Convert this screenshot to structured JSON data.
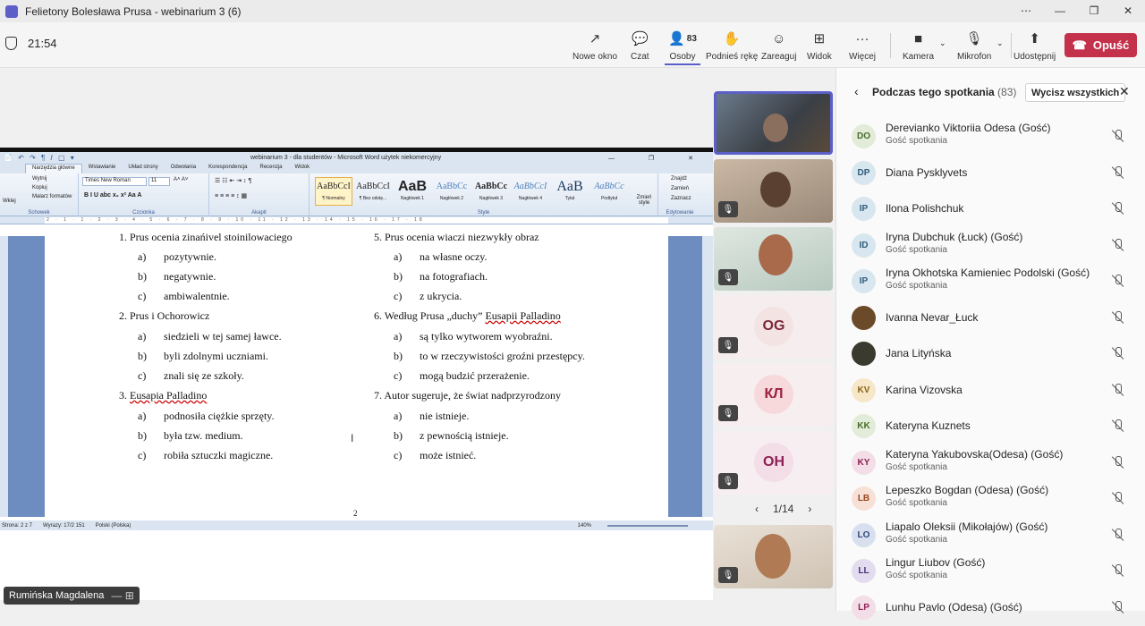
{
  "window": {
    "title": "Felietony Bolesława Prusa - webinarium 3 (6)",
    "controls": [
      "⋯",
      "—",
      "❐",
      "✕"
    ]
  },
  "meeting": {
    "timer": "21:54"
  },
  "toolbar": {
    "new_window": "Nowe okno",
    "chat": "Czat",
    "people": "Osoby",
    "people_count": "83",
    "raise_hand": "Podnieś rękę",
    "react": "Zareaguj",
    "view": "Widok",
    "more": "Więcej",
    "camera": "Kamera",
    "mic": "Mikrofon",
    "share": "Udostępnij",
    "leave": "Opuść",
    "icons": {
      "new_window": "↗",
      "chat": "💬",
      "people": "👤",
      "raise_hand": "✋",
      "react": "☺",
      "view": "⊞",
      "more": "···",
      "camera": "■",
      "mic": "🎙",
      "share": "⬆",
      "leave": "☎"
    }
  },
  "word": {
    "title": "webinarium 3 - dla studentów - Microsoft Word użytek niekomercyjny",
    "quick_access": "📄 ↶ ↷ ¶ 𝐼 ▢ ▾",
    "window_controls": "— ❐ ✕",
    "tabs": [
      "Narzędzia główne",
      "Wstawianie",
      "Układ strony",
      "Odwołania",
      "Korespondencja",
      "Recenzja",
      "Widok"
    ],
    "clipboard": {
      "paste": "Wklej",
      "cut": "Wytnij",
      "copy": "Kopiuj",
      "format": "Malarz formatów",
      "label": "Schowek"
    },
    "font": {
      "name": "Times New Roman",
      "size": "11",
      "label": "Czcionka",
      "grow": "A˄ A˅",
      "style_buttons": "B I U abc x₂ x² Aa A"
    },
    "paragraph": {
      "label": "Akapit",
      "row1": "☰ ☷ ⇤ ⇥ ↕ ¶",
      "row2": "≡ ≡ ≡ ≡ ↕ ▦"
    },
    "styles": [
      {
        "preview": "AaBbCcI",
        "name": "¶ Normalny"
      },
      {
        "preview": "AaBbCcI",
        "name": "¶ Bez odstę..."
      },
      {
        "preview": "AaB",
        "name": "Nagłówek 1"
      },
      {
        "preview": "AaBbCc",
        "name": "Nagłówek 2"
      },
      {
        "preview": "AaBbCc",
        "name": "Nagłówek 3"
      },
      {
        "preview": "AaBbCcI",
        "name": "Nagłówek 4"
      },
      {
        "preview": "AaB",
        "name": "Tytuł"
      },
      {
        "preview": "AaBbCc",
        "name": "Podtytuł"
      }
    ],
    "styles_label": "Style",
    "change_styles": "Zmień style",
    "editing": {
      "find": "Znajdź",
      "replace": "Zamień",
      "select": "Zaznacz",
      "label": "Edytowanie"
    },
    "ruler_marks": "2 · 1 · 1 · 2 · 3 · 4 · 5 · 6 · 7 · 8 · 9 · 10 · 11 · 12 · 13 · 14 · 15 · 16 · 17 · 18",
    "doc": {
      "top_cut_left": "1. Prus ocenia zinańivel stoinilowaciego",
      "top_cut_right": "5. Prus ocenia wiaczi niezwykły obraz",
      "q1_opts": [
        [
          "a)",
          "pozytywnie."
        ],
        [
          "b)",
          "negatywnie."
        ],
        [
          "c)",
          "ambiwalentnie."
        ]
      ],
      "q5_opts": [
        [
          "a)",
          "na własne oczy."
        ],
        [
          "b)",
          "na fotografiach."
        ],
        [
          "c)",
          "z ukrycia."
        ]
      ],
      "q2": "2. Prus i Ochorowicz",
      "q2_opts": [
        [
          "a)",
          "siedzieli w tej samej ławce."
        ],
        [
          "b)",
          "byli zdolnymi uczniami."
        ],
        [
          "c)",
          "znali się ze szkoły."
        ]
      ],
      "q6_pre": "6. Według Prusa „duchy” ",
      "q6_u": "Eusapii Palladino",
      "q6_opts": [
        [
          "a)",
          "są tylko wytworem wyobraźni."
        ],
        [
          "b)",
          "to w rzeczywistości groźni przestępcy."
        ],
        [
          "c)",
          "mogą budzić przerażenie."
        ]
      ],
      "q3_pre": "3. ",
      "q3_u": "Eusapia Palladino",
      "q3_opts": [
        [
          "a)",
          "podnosiła ciężkie sprzęty."
        ],
        [
          "b)",
          "była tzw. medium."
        ],
        [
          "c)",
          "robiła sztuczki magiczne."
        ]
      ],
      "q7": "7. Autor sugeruje, że świat nadprzyrodzony",
      "q7_opts": [
        [
          "a)",
          "nie istnieje."
        ],
        [
          "b)",
          "z pewnością istnieje."
        ],
        [
          "c)",
          "może istnieć."
        ]
      ],
      "page_number": "2"
    },
    "status": {
      "page": "Strona: 2 z 7",
      "words": "Wyrazy: 17/2 151",
      "lang": "Polski (Polska)",
      "zoom": "140%"
    }
  },
  "presenter": {
    "name": "Rumińska Magdalena",
    "controls": "— ⊞"
  },
  "gallery": {
    "tiles": [
      {
        "initials": "OG",
        "bg": "#f3e3e3",
        "fg": "#7a2a3a"
      },
      {
        "initials": "КЛ",
        "bg": "#f7d9dc",
        "fg": "#9b2040"
      },
      {
        "initials": "ОН",
        "bg": "#f3dde6",
        "fg": "#8e2054"
      }
    ],
    "page": "1/14"
  },
  "panel": {
    "title": "Podczas tego spotkania",
    "count": "(83)",
    "mute_all": "Wycisz wszystkich",
    "participants": [
      {
        "initials": "DO",
        "name": "Derevianko Viktoriia Odesa (Gość)",
        "role": "Gość spotkania",
        "bg": "#e2ecd8",
        "fg": "#4a6b2a"
      },
      {
        "initials": "DP",
        "name": "Diana Pysklyvets",
        "role": "",
        "bg": "#d8e6ef",
        "fg": "#2f5b7a"
      },
      {
        "initials": "IP",
        "name": "Ilona Polishchuk",
        "role": "",
        "bg": "#d8e6ef",
        "fg": "#2f5b7a"
      },
      {
        "initials": "ID",
        "name": "Iryna Dubchuk (Łuck) (Gość)",
        "role": "Gość spotkania",
        "bg": "#d8e6ef",
        "fg": "#2f5b7a"
      },
      {
        "initials": "IP",
        "name": "Iryna Okhotska Kamieniec Podolski (Gość)",
        "role": "Gość spotkania",
        "bg": "#d8e6ef",
        "fg": "#2f5b7a"
      },
      {
        "initials": "",
        "name": "Ivanna Nevar_Łuck",
        "role": "",
        "bg": "#6b4a2a",
        "fg": "#fff"
      },
      {
        "initials": "",
        "name": "Jana Lityńska",
        "role": "",
        "bg": "#3a3a2e",
        "fg": "#fff"
      },
      {
        "initials": "KV",
        "name": "Karina Vizovska",
        "role": "",
        "bg": "#f6e7c8",
        "fg": "#8a6414"
      },
      {
        "initials": "KK",
        "name": "Kateryna Kuznets",
        "role": "",
        "bg": "#e2ecd8",
        "fg": "#4a6b2a"
      },
      {
        "initials": "KY",
        "name": "Kateryna Yakubovska(Odesa) (Gość)",
        "role": "Gość spotkania",
        "bg": "#f3dde6",
        "fg": "#8e2054"
      },
      {
        "initials": "LB",
        "name": "Lepeszko Bogdan (Odesa) (Gość)",
        "role": "Gość spotkania",
        "bg": "#f7e0d6",
        "fg": "#9a4520"
      },
      {
        "initials": "LO",
        "name": "Liapalo Oleksii (Mikołajów) (Gość)",
        "role": "Gość spotkania",
        "bg": "#d8e0ef",
        "fg": "#2f4a7a"
      },
      {
        "initials": "LL",
        "name": "Lingur Liubov (Gość)",
        "role": "Gość spotkania",
        "bg": "#e3dcef",
        "fg": "#4a307a"
      },
      {
        "initials": "LP",
        "name": "Lunhu Pavlo (Odesa) (Gość)",
        "role": "",
        "bg": "#f3dde6",
        "fg": "#8e2054"
      }
    ]
  }
}
